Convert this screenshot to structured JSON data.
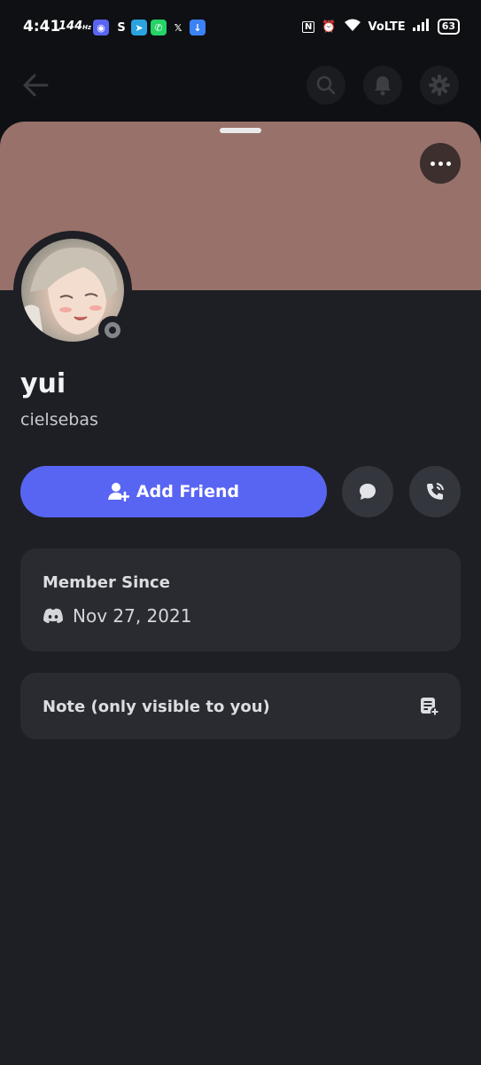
{
  "status_bar": {
    "time": "4:41",
    "refresh_rate": "144",
    "refresh_unit": "Hz",
    "network": "VoLTE",
    "battery": "63"
  },
  "profile": {
    "display_name": "yui",
    "username": "cielsebas",
    "banner_color": "#98716a",
    "status": "offline"
  },
  "actions": {
    "add_friend_label": "Add Friend"
  },
  "member_since": {
    "title": "Member Since",
    "date": "Nov 27, 2021"
  },
  "note": {
    "placeholder": "Note (only visible to you)"
  },
  "colors": {
    "accent": "#5865f2",
    "background": "#1e1f24",
    "card": "#2a2b31"
  }
}
